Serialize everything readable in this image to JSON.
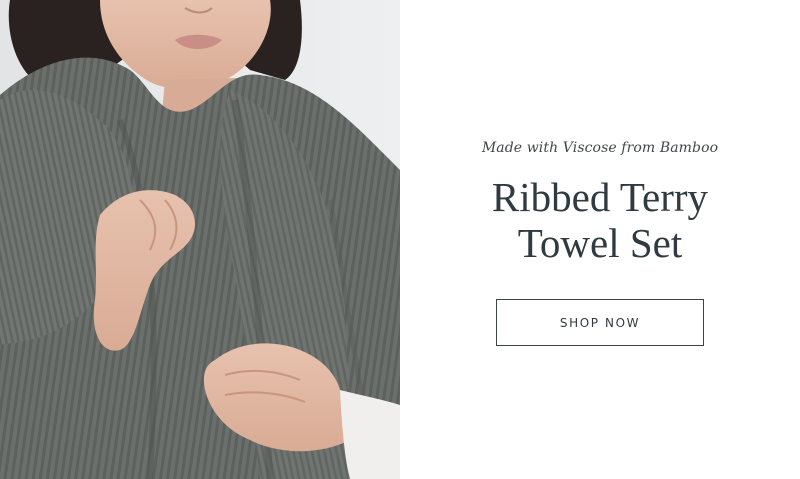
{
  "hero_image": {
    "subject": "woman wrapped in grey ribbed terry towel"
  },
  "content": {
    "kicker": "Made with Viscose from Bamboo",
    "title_line1": "Ribbed Terry",
    "title_line2": "Towel Set",
    "cta_label": "SHOP NOW"
  },
  "colors": {
    "text": "#2f3b41",
    "towel": "#6b6f6b",
    "background": "#ffffff"
  }
}
